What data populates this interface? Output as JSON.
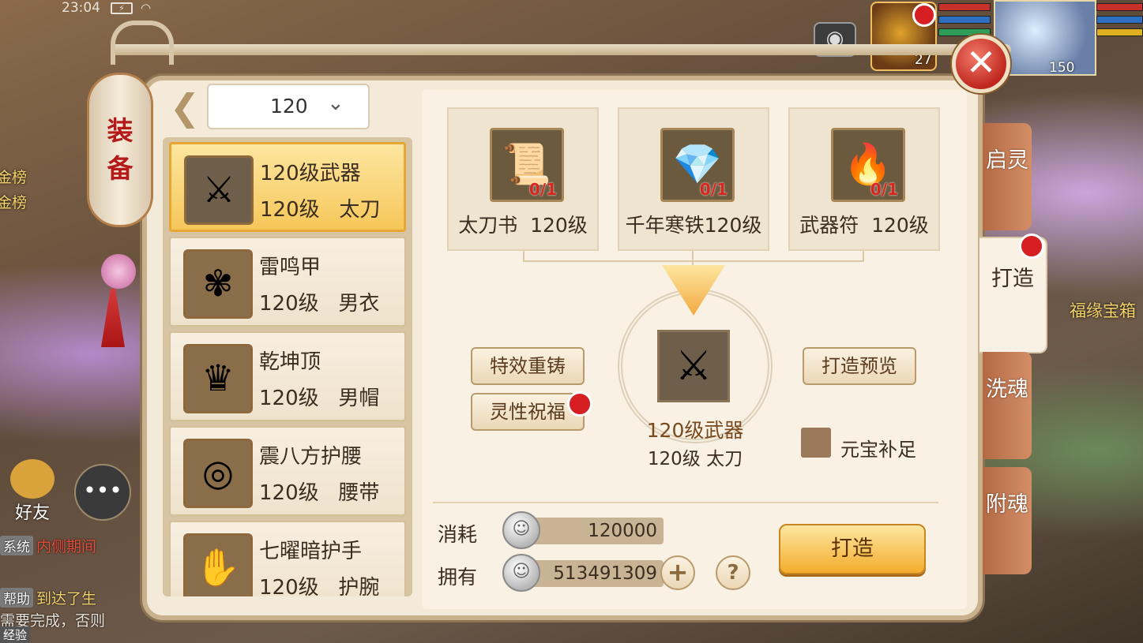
{
  "hud": {
    "time": "23:04",
    "pet_level": "27",
    "player_level": "150",
    "left_ranks": [
      "金榜",
      "金榜"
    ],
    "friend_label": "好友",
    "treasure_label": "福缘宝箱",
    "exp_label": "经验"
  },
  "chat": [
    {
      "tag": "系统",
      "text": "内侧期间"
    },
    {
      "tag": "帮助",
      "text": "到达了生"
    },
    {
      "tag": "",
      "text": "需要完成，否则"
    }
  ],
  "lantern": {
    "title_1": "装",
    "title_2": "备"
  },
  "close_icon": "✕",
  "level_selector": {
    "value": "120"
  },
  "equipment_list": [
    {
      "name": "120级武器",
      "sub": "120级   太刀",
      "icon": "⚔",
      "icon_bg": "#6e5e4a",
      "selected": true
    },
    {
      "name": "雷鸣甲",
      "sub": "120级   男衣",
      "icon": "✾",
      "icon_bg": "#8a6e4a",
      "selected": false
    },
    {
      "name": "乾坤顶",
      "sub": "120级   男帽",
      "icon": "♛",
      "icon_bg": "#8a6e4a",
      "selected": false
    },
    {
      "name": "震八方护腰",
      "sub": "120级   腰带",
      "icon": "◎",
      "icon_bg": "#8a6e4a",
      "selected": false
    },
    {
      "name": "七曜暗护手",
      "sub": "120级   护腕",
      "icon": "✋",
      "icon_bg": "#8a6e4a",
      "selected": false
    }
  ],
  "materials": [
    {
      "label": "太刀书  120级",
      "count": "0/1",
      "icon": "📜"
    },
    {
      "label": "千年寒铁120级",
      "count": "0/1",
      "icon": "💎"
    },
    {
      "label": "武器符  120级",
      "count": "0/1",
      "icon": "🔥"
    }
  ],
  "buttons": {
    "effect_recast": "特效重铸",
    "spirit_bless": "灵性祝福",
    "forge_preview": "打造预览",
    "forge": "打造"
  },
  "result": {
    "name": "120级武器",
    "sub": "120级 太刀"
  },
  "ingot_fill_label": "元宝补足",
  "cost": {
    "label": "消耗",
    "value": "120000"
  },
  "owned": {
    "label": "拥有",
    "value": "513491309"
  },
  "tabs": [
    "启灵",
    "打造",
    "洗魂",
    "附魂"
  ],
  "colors": {
    "accent": "#f3ad2d",
    "red_dot": "#d71f23",
    "panel": "#f3ead9"
  }
}
